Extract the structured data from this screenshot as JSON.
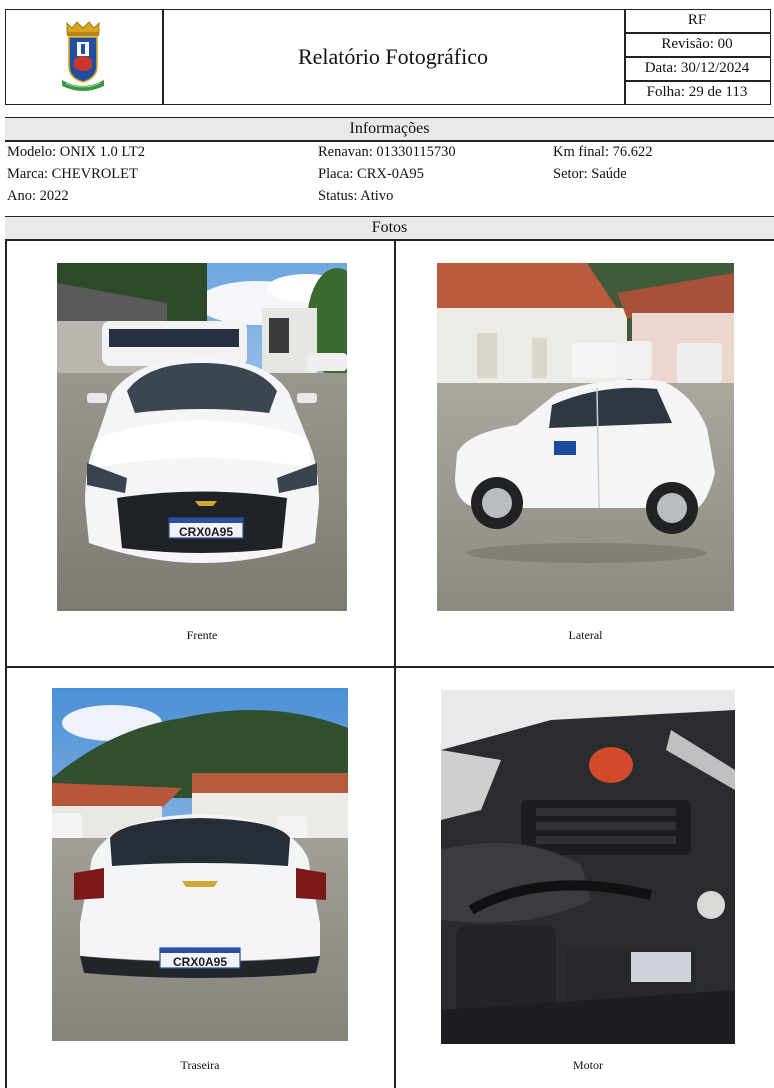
{
  "header": {
    "title": "Relatório Fotográfico",
    "code": "RF",
    "revision": "Revisão: 00",
    "date": "Data: 30/12/2024",
    "sheet": "Folha: 29 de 113"
  },
  "info": {
    "section_title": "Informações",
    "modelo": "Modelo: ONIX 1.0 LT2",
    "marca": "Marca: CHEVROLET",
    "ano": "Ano: 2022",
    "renavan": "Renavan: 01330115730",
    "placa": "Placa: CRX-0A95",
    "status": "Status: Ativo",
    "km_final": "Km final: 76.622",
    "setor": "Setor: Saúde"
  },
  "photos": {
    "section_title": "Fotos",
    "items": [
      {
        "caption": "Frente",
        "plate": "CRX0A95"
      },
      {
        "caption": "Lateral"
      },
      {
        "caption": "Traseira",
        "plate": "CRX0A95"
      },
      {
        "caption": "Motor"
      }
    ]
  },
  "colors": {
    "border": "#222222",
    "section_bg": "#e9e9e9",
    "crest_blue": "#1f4ea3",
    "crest_gold": "#d8a51d",
    "crest_red": "#c9362d",
    "crest_green": "#3a9b3f"
  }
}
